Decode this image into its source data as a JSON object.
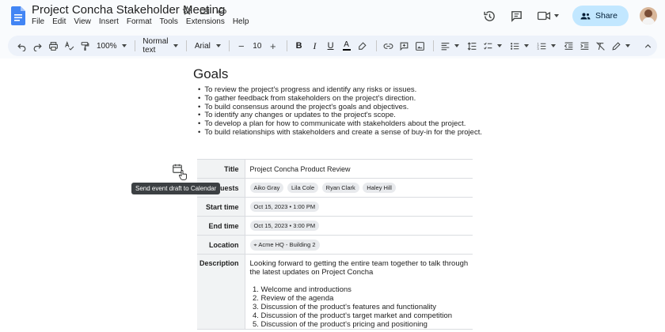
{
  "app": {
    "doc_title": "Project Concha Stakeholder Meeting",
    "menu": [
      "File",
      "Edit",
      "View",
      "Insert",
      "Format",
      "Tools",
      "Extensions",
      "Help"
    ],
    "share_label": "Share"
  },
  "toolbar": {
    "zoom": "100%",
    "style": "Normal text",
    "font": "Arial",
    "font_size": "10"
  },
  "doc": {
    "heading": "Goals",
    "goals": [
      "To review the project's progress and identify any risks or issues.",
      "To gather feedback from stakeholders on the project's direction.",
      "To build consensus around the project's goals and objectives.",
      "To identify any changes or updates to the project's scope.",
      "To develop a plan for how to communicate with stakeholders about the project.",
      "To build relationships with stakeholders and create a sense of buy-in for the project."
    ],
    "tooltip": "Send event draft to Calendar"
  },
  "event": {
    "title_label": "Title",
    "title_value": "Project Concha Product Review",
    "guests_label": "Guests",
    "guests": [
      "Aiko Gray",
      "Lila Cole",
      "Ryan Clark",
      "Haley Hill"
    ],
    "start_label": "Start time",
    "start_value": "Oct 15, 2023 • 1:00 PM",
    "end_label": "End time",
    "end_value": "Oct 15, 2023 • 3:00 PM",
    "location_label": "Location",
    "location_value": "Acme HQ - Building 2",
    "description_label": "Description",
    "description_intro": "Looking forward to getting the entire team together to talk through the latest updates on Project Concha",
    "agenda": [
      "Welcome and introductions",
      "Review of the agenda",
      "Discussion of the product's features and functionality",
      "Discussion of the product's target market and competition",
      "Discussion of the product's pricing and positioning"
    ]
  },
  "colors": {
    "docs_blue": "#4285f4",
    "share_bg": "#c2e7ff",
    "toolbar_bg": "#edf2fa"
  }
}
